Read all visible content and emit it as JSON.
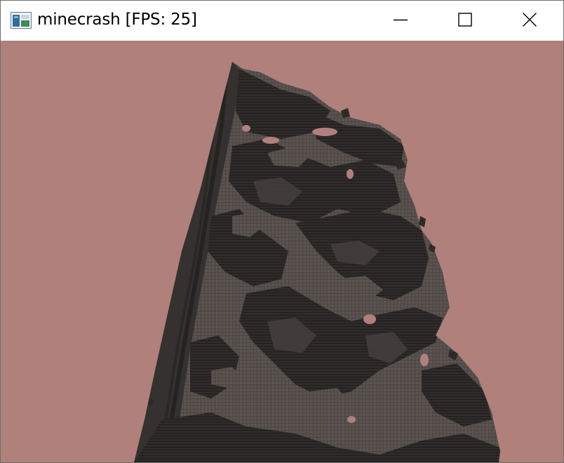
{
  "window": {
    "title": "minecrash [FPS: 25]",
    "icon": "app-window-icon",
    "controls": [
      {
        "name": "minimize",
        "icon": "minimize-icon"
      },
      {
        "name": "maximize",
        "icon": "maximize-icon"
      },
      {
        "name": "close",
        "icon": "close-icon"
      }
    ]
  },
  "colors": {
    "sky": "#b0807a",
    "terrain_light": "#5b5350",
    "terrain_dark": "#2d2a29",
    "terrain_mid": "#403b39"
  }
}
